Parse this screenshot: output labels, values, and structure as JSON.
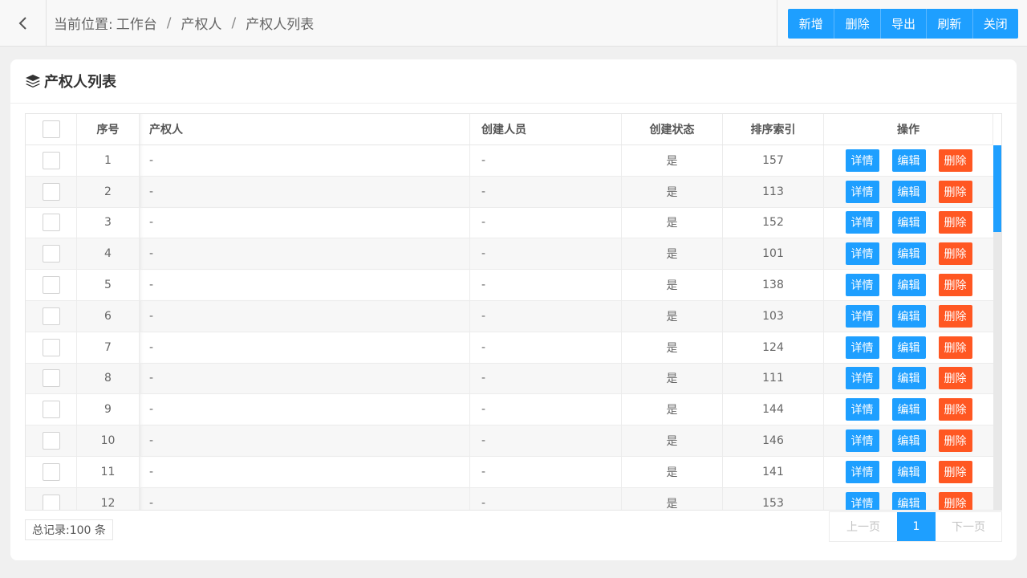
{
  "breadcrumb": {
    "label": "当前位置:",
    "items": [
      "工作台",
      "产权人",
      "产权人列表"
    ],
    "sep": "/"
  },
  "toolbar": [
    "新增",
    "删除",
    "导出",
    "刷新",
    "关闭"
  ],
  "card": {
    "title": "产权人列表",
    "icon": "layers-icon"
  },
  "table": {
    "columns": {
      "index": "序号",
      "owner": "产权人",
      "creator": "创建人员",
      "status": "创建状态",
      "sort": "排序索引",
      "ops": "操作"
    },
    "actions": {
      "detail": "详情",
      "edit": "编辑",
      "delete": "删除"
    },
    "rows": [
      {
        "index": "1",
        "owner": "-",
        "creator": "-",
        "status": "是",
        "sort": "157"
      },
      {
        "index": "2",
        "owner": "-",
        "creator": "-",
        "status": "是",
        "sort": "113"
      },
      {
        "index": "3",
        "owner": "-",
        "creator": "-",
        "status": "是",
        "sort": "152"
      },
      {
        "index": "4",
        "owner": "-",
        "creator": "-",
        "status": "是",
        "sort": "101"
      },
      {
        "index": "5",
        "owner": "-",
        "creator": "-",
        "status": "是",
        "sort": "138"
      },
      {
        "index": "6",
        "owner": "-",
        "creator": "-",
        "status": "是",
        "sort": "103"
      },
      {
        "index": "7",
        "owner": "-",
        "creator": "-",
        "status": "是",
        "sort": "124"
      },
      {
        "index": "8",
        "owner": "-",
        "creator": "-",
        "status": "是",
        "sort": "111"
      },
      {
        "index": "9",
        "owner": "-",
        "creator": "-",
        "status": "是",
        "sort": "144"
      },
      {
        "index": "10",
        "owner": "-",
        "creator": "-",
        "status": "是",
        "sort": "146"
      },
      {
        "index": "11",
        "owner": "-",
        "creator": "-",
        "status": "是",
        "sort": "141"
      },
      {
        "index": "12",
        "owner": "-",
        "creator": "-",
        "status": "是",
        "sort": "153"
      }
    ]
  },
  "footer": {
    "total": "总记录:100 条",
    "prev": "上一页",
    "current": "1",
    "next": "下一页"
  },
  "colors": {
    "primary": "#1e9fff",
    "danger": "#ff5722"
  }
}
